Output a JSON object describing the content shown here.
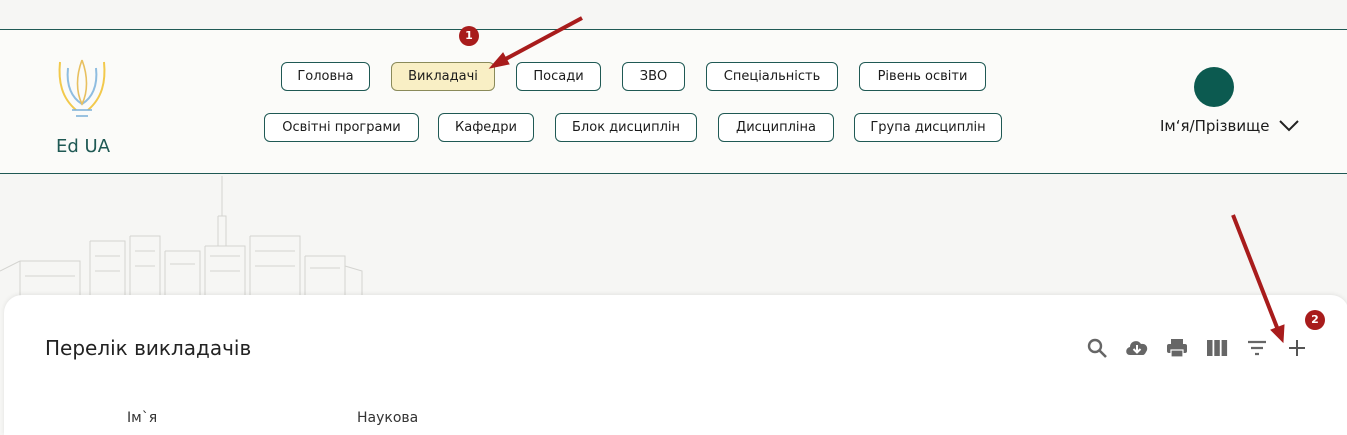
{
  "brand": {
    "name": "Ed UA"
  },
  "nav": {
    "row1": [
      "Головна",
      "Викладачі",
      "Посади",
      "ЗВО",
      "Спеціальність",
      "Рівень освіти"
    ],
    "row2": [
      "Освітні програми",
      "Кафедри",
      "Блок дисциплін",
      "Дисципліна",
      "Група дисциплін"
    ],
    "active": "Викладачі"
  },
  "user": {
    "name": "Ім‘я/Прізвище",
    "avatar_color": "#0c5a50"
  },
  "main": {
    "title": "Перелік викладачів",
    "toolbar_icons": [
      "search-icon",
      "download-icon",
      "print-icon",
      "columns-icon",
      "filter-icon",
      "add-icon"
    ],
    "columns": [
      "Ім`я",
      "Наукова"
    ]
  },
  "annotations": {
    "badge1": "1",
    "badge2": "2"
  },
  "colors": {
    "accent": "#1f5954",
    "active_bg": "#f9efc5",
    "annotation": "#a81c1c"
  }
}
